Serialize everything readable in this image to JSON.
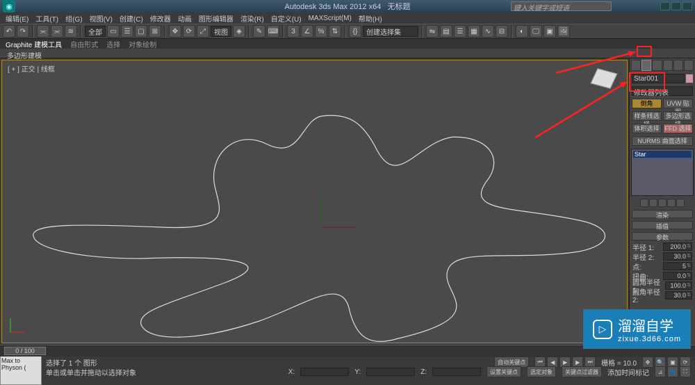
{
  "titlebar": {
    "product": "Autodesk 3ds Max 2012 x64",
    "doc": "无标题",
    "search_placeholder": "键入关键字或短语"
  },
  "menu": {
    "edit": "编辑(E)",
    "tools": "工具(T)",
    "group": "组(G)",
    "views": "视图(V)",
    "create": "创建(C)",
    "modifiers": "修改器",
    "animation": "动画",
    "graph": "图形编辑器",
    "render": "渲染(R)",
    "custom": "自定义(U)",
    "maxscript": "MAXScript(M)",
    "help": "帮助(H)"
  },
  "toolbar": {
    "selection_filter": "全部",
    "ref_coord": "视图"
  },
  "ribbon": {
    "tab1": "Graphite 建模工具",
    "tab2": "自由形式",
    "tab3": "选择",
    "tab4": "对象绘制",
    "panel": "多边形建模"
  },
  "viewport": {
    "label": "[ + ] 正交 | 线框"
  },
  "cmdpanel": {
    "object_name": "Star001",
    "modlist_label": "修改器列表",
    "btn_bevel": "倒角",
    "btn_uvw": "UVW 贴图",
    "btn_spline_sel": "样条线选择",
    "btn_poly_sel": "多边形选择",
    "btn_vol_sel": "体积选择",
    "btn_ffd": "FFD 选择",
    "btn_nurms": "NURMS 曲面选择",
    "stack_item": "Star",
    "rollout_render": "渲染",
    "rollout_interp": "插值",
    "rollout_params": "参数",
    "p_radius1_lbl": "半径 1:",
    "p_radius1_val": "200.0",
    "p_radius2_lbl": "半径 2:",
    "p_radius2_val": "30.0",
    "p_points_lbl": "点:",
    "p_points_val": "5",
    "p_distort_lbl": "扭曲:",
    "p_distort_val": "0.0",
    "p_fillet1_lbl": "圆角半径 1:",
    "p_fillet1_val": "100.0",
    "p_fillet2_lbl": "圆角半径 2:",
    "p_fillet2_val": "30.0"
  },
  "timeline": {
    "frame": "0 / 100"
  },
  "status": {
    "script_btn": "Max to Physon (",
    "sel_info": "选择了 1 个 图形",
    "prompt": "单击或单击并拖动以选择对象",
    "add_time": "添加时间标记",
    "x": "X:",
    "y": "Y:",
    "z": "Z:",
    "grid_lbl": "栅格 = 10.0",
    "autokey": "自动关键点",
    "setkey": "设置关键点",
    "keyfilter": "选定对象",
    "keyfilter2": "关键点过滤器"
  },
  "watermark": {
    "brand": "溜溜自学",
    "url": "zixue.3d66.com"
  }
}
